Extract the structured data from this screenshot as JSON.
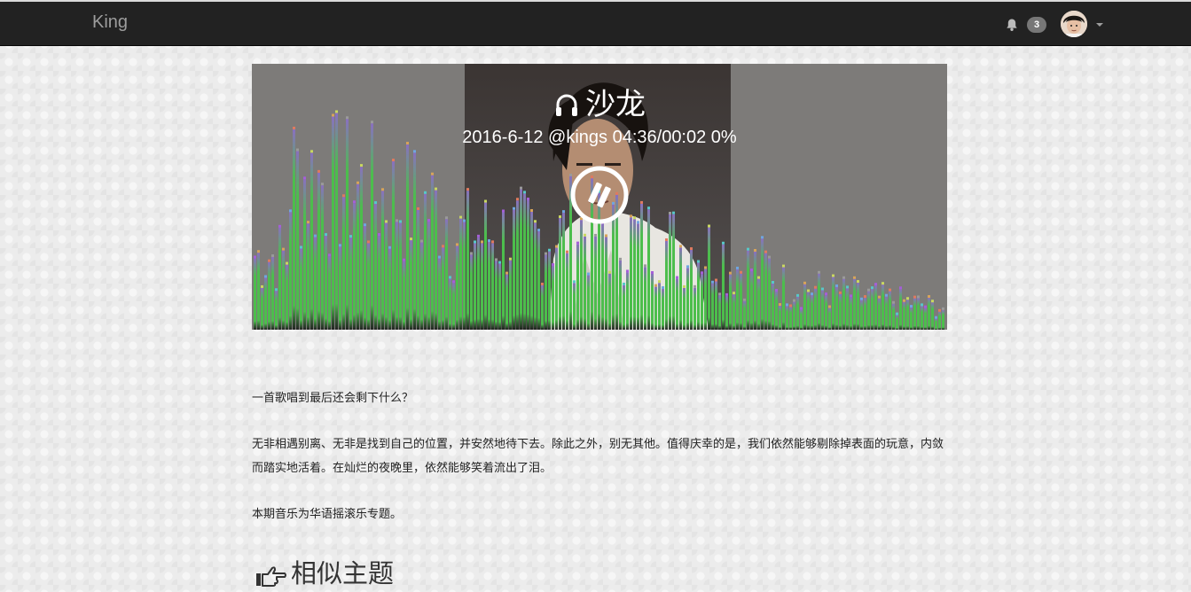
{
  "navbar": {
    "brand": "King",
    "notification_icon": "bell-icon",
    "notification_count": "3",
    "user_menu_icon": "caret-down-icon"
  },
  "player": {
    "icon": "headphones-icon",
    "title": "沙龙",
    "meta": "2016-6-12 @kings 04:36/00:02 0%",
    "control_icon": "pause-icon",
    "colors": {
      "overlay": "#7d7b79",
      "bars": "#4cbe4c"
    }
  },
  "article": {
    "paragraphs": [
      "一首歌唱到最后还会剩下什么？",
      "无非相遇别离、无非是找到自己的位置，并安然地待下去。除此之外，别无其他。值得庆幸的是，我们依然能够剔除掉表面的玩意，内敛而踏实地活着。在灿烂的夜晚里，依然能够笑着流出了泪。",
      "本期音乐为华语摇滚乐专题。"
    ]
  },
  "related": {
    "icon": "hand-pointing-right-icon",
    "heading": "相似主题"
  }
}
